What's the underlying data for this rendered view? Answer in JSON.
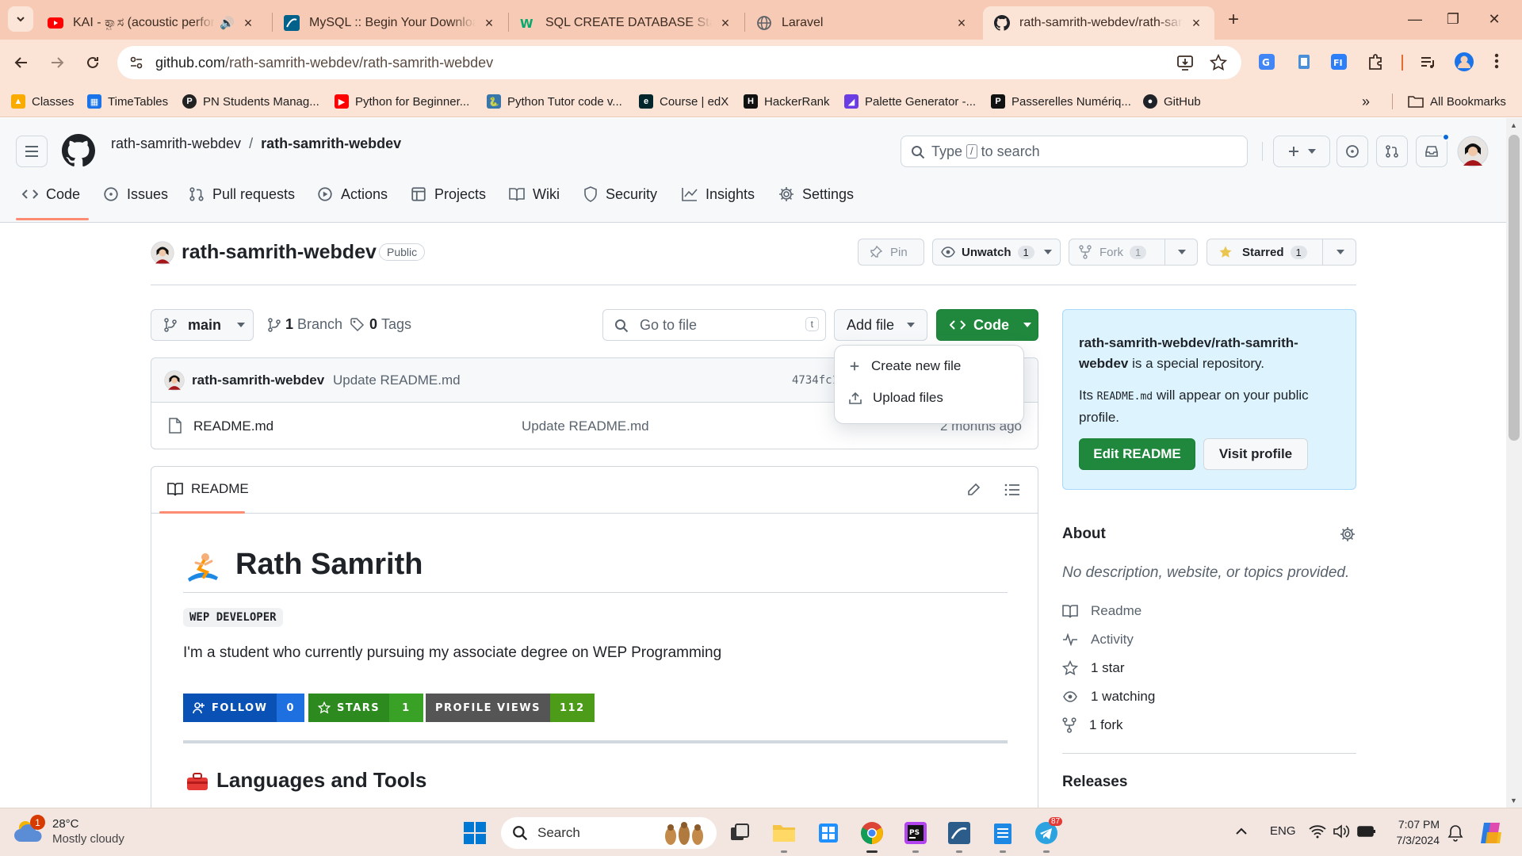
{
  "browser": {
    "tabs": [
      {
        "title": "KAI - ಕ್ವಾಸ (acoustic perform",
        "favicon": "youtube-icon",
        "color": "#ff0000",
        "audio": true
      },
      {
        "title": "MySQL :: Begin Your Download",
        "favicon": "mysql-icon",
        "color": "#00618a"
      },
      {
        "title": "SQL CREATE DATABASE Statem",
        "favicon": "w3schools-icon",
        "color": "#04aa6d"
      },
      {
        "title": "Laravel",
        "favicon": "globe-icon",
        "color": "#5f6368"
      },
      {
        "title": "rath-samrith-webdev/rath-samr",
        "favicon": "github-icon",
        "color": "#1f2328"
      }
    ],
    "url": {
      "host": "github.com",
      "path": "/rath-samrith-webdev/rath-samrith-webdev"
    },
    "bookmarks": [
      {
        "label": "Classes",
        "icon": "classroom-icon",
        "color": "#f9ab00"
      },
      {
        "label": "TimeTables",
        "icon": "timetable-icon",
        "color": "#1a73e8"
      },
      {
        "label": "PN Students Manag...",
        "icon": "pn-icon",
        "color": "#222222"
      },
      {
        "label": "Python for Beginner...",
        "icon": "youtube-icon",
        "color": "#ff0000"
      },
      {
        "label": "Python Tutor code v...",
        "icon": "python-icon",
        "color": "#3776ab"
      },
      {
        "label": "Course | edX",
        "icon": "edx-icon",
        "color": "#02262b"
      },
      {
        "label": "HackerRank",
        "icon": "hackerrank-icon",
        "color": "#111111"
      },
      {
        "label": "Palette Generator -...",
        "icon": "palette-icon",
        "color": "#6a3ce3"
      },
      {
        "label": "Passerelles Numériq...",
        "icon": "pn-icon",
        "color": "#111111"
      },
      {
        "label": "GitHub",
        "icon": "github-icon",
        "color": "#1f2328"
      }
    ],
    "all_bookmarks": "All Bookmarks"
  },
  "github": {
    "owner": "rath-samrith-webdev",
    "repo": "rath-samrith-webdev",
    "search_placeholder_pre": "Type",
    "search_key": "/",
    "search_placeholder_post": "to search",
    "nav": [
      "Code",
      "Issues",
      "Pull requests",
      "Actions",
      "Projects",
      "Wiki",
      "Security",
      "Insights",
      "Settings"
    ],
    "visibility": "Public",
    "pin": "Pin",
    "unwatch": "Unwatch",
    "watch_count": "1",
    "fork": "Fork",
    "fork_count": "1",
    "starred": "Starred",
    "star_count": "1",
    "branch": "main",
    "branch_count": "1",
    "branch_label": "Branch",
    "tag_count": "0",
    "tag_label": "Tags",
    "goto_placeholder": "Go to file",
    "goto_key": "t",
    "add_file": "Add file",
    "code_btn": "Code",
    "dropdown": [
      "Create new file",
      "Upload files"
    ],
    "commit": {
      "author": "rath-samrith-webdev",
      "message": "Update README.md",
      "sha": "4734fc1"
    },
    "files": [
      {
        "name": "README.md",
        "message": "Update README.md",
        "age": "2 months ago"
      }
    ],
    "readme_tab": "README",
    "readme": {
      "title": "Rath Samrith",
      "badge": "WEP DEVELOPER",
      "intro": "I'm a student who currently pursuing my associate degree on WEP Programming",
      "shields": [
        {
          "label": "FOLLOW",
          "value": "0",
          "color": "#0a51b5",
          "value_color": "#1e6fe0"
        },
        {
          "label": "STARS",
          "value": "1",
          "color": "#2d8a1e",
          "value_color": "#3aa127"
        },
        {
          "label": "PROFILE VIEWS",
          "value": "112",
          "color": "#555555",
          "value_color": "#4c9c1a"
        }
      ],
      "languages_heading": "Languages and Tools"
    },
    "special": {
      "repo_line1": "rath-samrith-webdev/rath-samrith-",
      "repo_line2": "webdev",
      "is_special": " is a special repository.",
      "its": "Its ",
      "readme_code": "README.md",
      "appear": " will appear on your public profile.",
      "edit_btn": "Edit README",
      "visit_btn": "Visit profile"
    },
    "about": {
      "title": "About",
      "description": "No description, website, or topics provided.",
      "items": [
        {
          "label": "Readme",
          "icon": "book-icon"
        },
        {
          "label": "Activity",
          "icon": "pulse-icon"
        },
        {
          "label": "1 star",
          "icon": "star-icon"
        },
        {
          "label": "1 watching",
          "icon": "eye-icon"
        },
        {
          "label": "1 fork",
          "icon": "fork-icon"
        }
      ],
      "releases": "Releases"
    }
  },
  "taskbar": {
    "weather_temp": "28°C",
    "weather_desc": "Mostly cloudy",
    "weather_badge": "1",
    "search": "Search",
    "lang": "ENG",
    "time": "7:07 PM",
    "date": "7/3/2024",
    "telegram_badge": "87"
  }
}
